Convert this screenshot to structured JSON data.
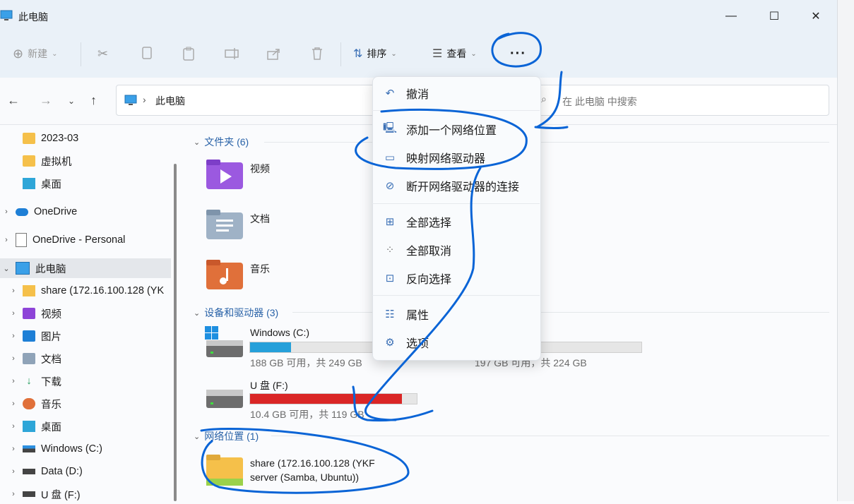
{
  "window": {
    "title": "此电脑",
    "minimize": "—",
    "maximize": "☐",
    "close": "✕"
  },
  "toolbar": {
    "new_label": "新建",
    "sort_label": "排序",
    "view_label": "查看",
    "more_label": "···"
  },
  "address": {
    "path_item": "此电脑",
    "separator": "›",
    "search_placeholder": "在 此电脑 中搜索"
  },
  "sidebar": {
    "items": [
      {
        "label": "2023-03",
        "icon": "folder-icon"
      },
      {
        "label": "虚拟机",
        "icon": "folder-icon"
      },
      {
        "label": "桌面",
        "icon": "desktop-icon"
      },
      {
        "label": "OneDrive",
        "icon": "cloud-icon"
      },
      {
        "label": "OneDrive - Personal",
        "icon": "file-icon"
      },
      {
        "label": "此电脑",
        "icon": "pc-icon"
      },
      {
        "label": "share (172.16.100.128 (YK",
        "icon": "network-folder-icon"
      },
      {
        "label": "视频",
        "icon": "video-icon"
      },
      {
        "label": "图片",
        "icon": "picture-icon"
      },
      {
        "label": "文档",
        "icon": "document-icon"
      },
      {
        "label": "下载",
        "icon": "download-icon"
      },
      {
        "label": "音乐",
        "icon": "music-icon"
      },
      {
        "label": "桌面",
        "icon": "desktop-icon"
      },
      {
        "label": "Windows (C:)",
        "icon": "drive-icon"
      },
      {
        "label": "Data (D:)",
        "icon": "drive-icon"
      },
      {
        "label": "U 盘 (F:)",
        "icon": "drive-icon"
      }
    ]
  },
  "content": {
    "folders_header": "文件夹 (6)",
    "folders": [
      "视频",
      "文档",
      "音乐"
    ],
    "devices_header": "设备和驱动器 (3)",
    "drives": [
      {
        "name": "Windows (C:)",
        "free": "188 GB 可用，共 249 GB",
        "used_fraction": 0.245,
        "color": "#26a0da"
      },
      {
        "name": "",
        "free": "197 GB 可用，共 224 GB",
        "used_fraction": 0.12,
        "color": "#26a0da"
      },
      {
        "name": "U 盘 (F:)",
        "free": "10.4 GB 可用，共 119 GB",
        "used_fraction": 0.91,
        "color": "#da2626"
      }
    ],
    "network_header": "网络位置 (1)",
    "network_item_line1": "share (172.16.100.128 (YKF",
    "network_item_line2": "server (Samba, Ubuntu))"
  },
  "menu": {
    "undo": "撤消",
    "add_network_location": "添加一个网络位置",
    "map_network_drive": "映射网络驱动器",
    "disconnect_network_drive": "断开网络驱动器的连接",
    "select_all": "全部选择",
    "select_none": "全部取消",
    "invert_selection": "反向选择",
    "properties": "属性",
    "options": "选项"
  },
  "colors": {
    "accent": "#0067c0",
    "ink": "#0a64d6"
  }
}
